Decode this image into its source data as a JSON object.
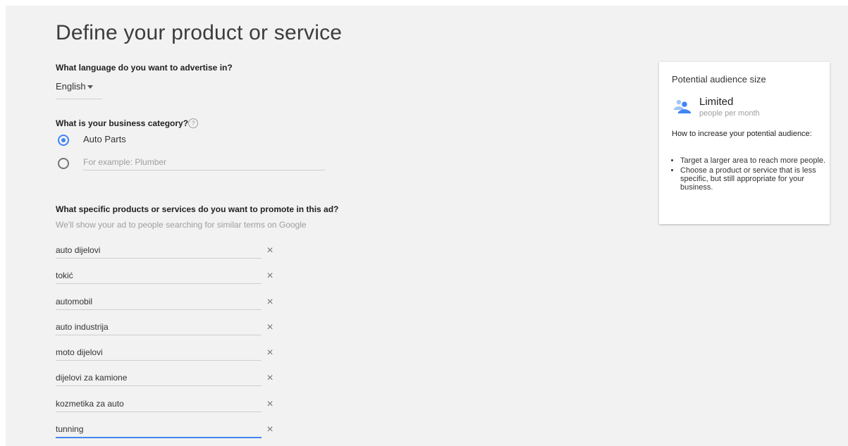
{
  "page": {
    "title": "Define your product or service"
  },
  "language": {
    "question": "What language do you want to advertise in?",
    "selected": "English"
  },
  "category": {
    "question": "What is your business category?",
    "help_icon": "help-circle-icon",
    "options": [
      {
        "label": "Auto Parts",
        "checked": true
      },
      {
        "placeholder": "For example: Plumber",
        "checked": false
      }
    ]
  },
  "products": {
    "question": "What specific products or services do you want to promote in this ad?",
    "hint": "We'll show your ad to people searching for similar terms on Google",
    "keywords": [
      "auto dijelovi",
      "tokić",
      "automobil",
      "auto industrija",
      "moto dijelovi",
      "dijelovi za kamione",
      "kozmetika za auto",
      "tunning"
    ],
    "remove_icon": "close-icon"
  },
  "audience": {
    "title": "Potential audience size",
    "icon": "people-icon",
    "level": "Limited",
    "unit": "people per month",
    "how_heading": "How to increase your potential audience:",
    "tips": [
      "Target a larger area to reach more people.",
      "Choose a product or service that is less specific, but still appropriate for your business."
    ]
  },
  "colors": {
    "accent": "#4285f4",
    "background": "#f2f2f2",
    "card": "#ffffff"
  }
}
